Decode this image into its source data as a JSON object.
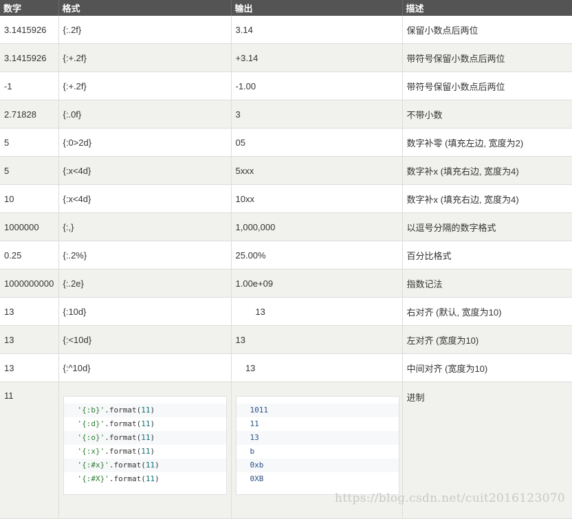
{
  "headers": [
    "数字",
    "格式",
    "输出",
    "描述"
  ],
  "rows": [
    {
      "num": "3.1415926",
      "fmt": "{:.2f}",
      "out": "3.14",
      "desc": "保留小数点后两位"
    },
    {
      "num": "3.1415926",
      "fmt": "{:+.2f}",
      "out": "+3.14",
      "desc": "带符号保留小数点后两位"
    },
    {
      "num": "-1",
      "fmt": "{:+.2f}",
      "out": "-1.00",
      "desc": "带符号保留小数点后两位"
    },
    {
      "num": "2.71828",
      "fmt": "{:.0f}",
      "out": "3",
      "desc": "不带小数"
    },
    {
      "num": "5",
      "fmt": "{:0>2d}",
      "out": "05",
      "desc": "数字补零 (填充左边, 宽度为2)"
    },
    {
      "num": "5",
      "fmt": "{:x<4d}",
      "out": "5xxx",
      "desc": "数字补x (填充右边, 宽度为4)"
    },
    {
      "num": "10",
      "fmt": "{:x<4d}",
      "out": "10xx",
      "desc": "数字补x (填充右边, 宽度为4)"
    },
    {
      "num": "1000000",
      "fmt": "{:,}",
      "out": "1,000,000",
      "desc": "以逗号分隔的数字格式"
    },
    {
      "num": "0.25",
      "fmt": "{:.2%}",
      "out": "25.00%",
      "desc": "百分比格式"
    },
    {
      "num": "1000000000",
      "fmt": "{:.2e}",
      "out": "1.00e+09",
      "desc": "指数记法"
    },
    {
      "num": "13",
      "fmt": "{:10d}",
      "out": "        13",
      "desc": "右对齐 (默认, 宽度为10)"
    },
    {
      "num": "13",
      "fmt": "{:<10d}",
      "out": "13",
      "desc": "左对齐 (宽度为10)"
    },
    {
      "num": "13",
      "fmt": "{:^10d}",
      "out": "    13",
      "desc": "中间对齐 (宽度为10)"
    }
  ],
  "base_row": {
    "num": "11",
    "desc": "进制",
    "code_lines": [
      {
        "str": "'{:b}'",
        "method": ".format(",
        "arg": "11",
        "close": ")"
      },
      {
        "str": "'{:d}'",
        "method": ".format(",
        "arg": "11",
        "close": ")"
      },
      {
        "str": "'{:o}'",
        "method": ".format(",
        "arg": "11",
        "close": ")"
      },
      {
        "str": "'{:x}'",
        "method": ".format(",
        "arg": "11",
        "close": ")"
      },
      {
        "str": "'{:#x}'",
        "method": ".format(",
        "arg": "11",
        "close": ")"
      },
      {
        "str": "'{:#X}'",
        "method": ".format(",
        "arg": "11",
        "close": ")"
      }
    ],
    "outputs": [
      "1011",
      "11",
      "13",
      "b",
      "0xb",
      "0XB"
    ]
  },
  "watermark": "https://blog.csdn.net/cuit2016123070"
}
